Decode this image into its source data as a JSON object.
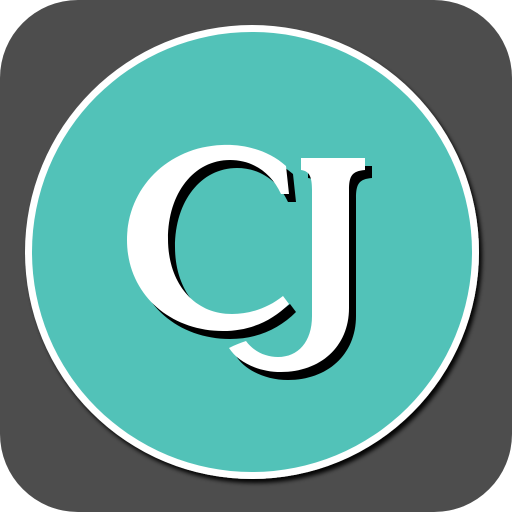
{
  "app_icon": {
    "monogram": "CJ",
    "colors": {
      "tile_background": "#4d4d4d",
      "circle_fill": "#52c2b8",
      "circle_border": "#ffffff",
      "letter_fill": "#ffffff",
      "letter_shadow": "#000000"
    }
  }
}
